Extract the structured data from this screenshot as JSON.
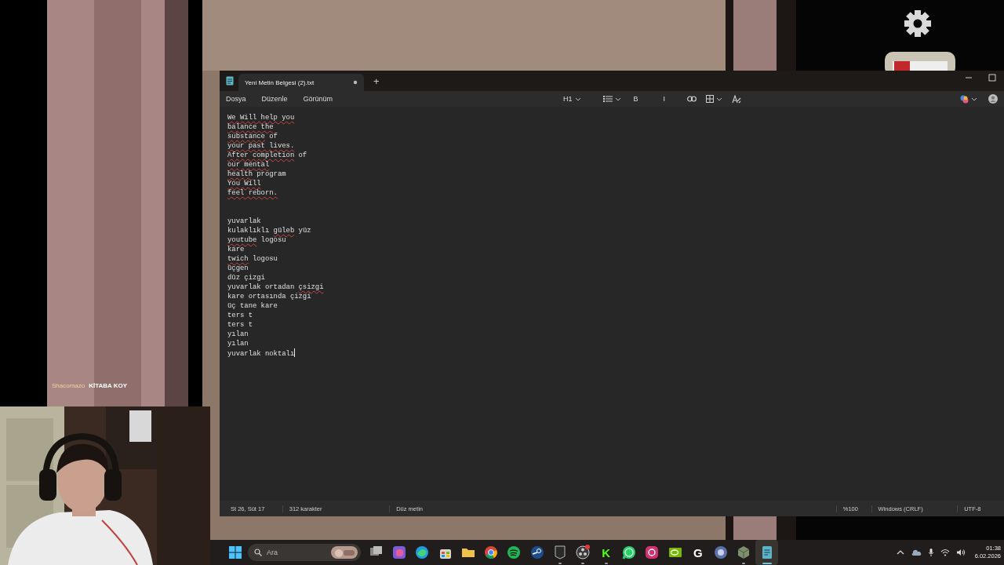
{
  "overlay": {
    "username": "Shacomazo",
    "message": "KİTABA KOY"
  },
  "notepad": {
    "tabs": [
      {
        "title": "Yeni Metin Belgesi (2).txt",
        "selected": true,
        "modified": true
      }
    ],
    "new_tab": "+",
    "menu": [
      "Dosya",
      "Düzenle",
      "Görünüm"
    ],
    "toolbar": [
      {
        "kind": "heading",
        "label": "H1",
        "dropdown": true
      },
      {
        "kind": "list",
        "dropdown": true
      },
      {
        "kind": "bold",
        "glyph": "B"
      },
      {
        "kind": "italic",
        "glyph": "I"
      },
      {
        "kind": "link"
      },
      {
        "kind": "table",
        "dropdown": true
      },
      {
        "kind": "clear-format"
      }
    ],
    "blocks": [
      {
        "lines": [
          [
            {
              "text": "We Will help you",
              "flagged": true
            }
          ],
          [
            {
              "text": "balance the",
              "flagged": true
            }
          ],
          [
            {
              "text": "substance",
              "flagged": true
            },
            {
              "text": " of",
              "flagged": false
            }
          ],
          [
            {
              "text": "your past lives.",
              "flagged": true
            }
          ],
          [
            {
              "text": "After completion",
              "flagged": true
            },
            {
              "text": " of",
              "flagged": false
            }
          ],
          [
            {
              "text": "our mental",
              "flagged": true
            }
          ],
          [
            {
              "text": "health",
              "flagged": true
            },
            {
              "text": " program",
              "flagged": false
            }
          ],
          [
            {
              "text": "You Will",
              "flagged": true
            }
          ],
          [
            {
              "text": "feel reborn.",
              "flagged": true
            }
          ]
        ]
      },
      {
        "lines": [
          [
            {
              "text": "yuvarlak",
              "flagged": false
            }
          ],
          [
            {
              "text": "kulaklıklı ",
              "flagged": false
            },
            {
              "text": "güleb",
              "flagged": true
            },
            {
              "text": " yüz",
              "flagged": false
            }
          ],
          [
            {
              "text": "youtube",
              "flagged": true
            },
            {
              "text": " logosu",
              "flagged": false
            }
          ],
          [
            {
              "text": "kare",
              "flagged": false
            }
          ],
          [
            {
              "text": "twich",
              "flagged": true
            },
            {
              "text": " logosu",
              "flagged": false
            }
          ],
          [
            {
              "text": "üçgen",
              "flagged": false
            }
          ],
          [
            {
              "text": "düz çizgi",
              "flagged": false
            }
          ],
          [
            {
              "text": "yuvarlak ortadan ",
              "flagged": false
            },
            {
              "text": "çsizgi",
              "flagged": true
            }
          ],
          [
            {
              "text": "kare ortasında çizgi",
              "flagged": false
            }
          ],
          [
            {
              "text": "üç tane kare",
              "flagged": false
            }
          ],
          [
            {
              "text": "ters t",
              "flagged": false
            }
          ],
          [
            {
              "text": "ters t",
              "flagged": false
            }
          ],
          [
            {
              "text": "yılan",
              "flagged": false
            }
          ],
          [
            {
              "text": "yılan",
              "flagged": false
            }
          ],
          [
            {
              "text": "yuvarlak noktalı",
              "flagged": false
            }
          ]
        ]
      }
    ],
    "status": {
      "position": "St 26, Süt 17",
      "count": "312 karakter",
      "format": "Düz metin",
      "zoom": "%100",
      "line_ending": "Windows (CRLF)",
      "encoding": "UTF-8"
    }
  },
  "taskbar": {
    "search_placeholder": "Ara",
    "apps": [
      {
        "kind": "task-view",
        "running": false
      },
      {
        "kind": "copilot",
        "running": false
      },
      {
        "kind": "edge",
        "running": false
      },
      {
        "kind": "store",
        "running": false
      },
      {
        "kind": "folder",
        "running": false
      },
      {
        "kind": "chrome",
        "running": false
      },
      {
        "kind": "spotify",
        "running": false
      },
      {
        "kind": "steam",
        "running": false
      },
      {
        "kind": "epic",
        "running": true
      },
      {
        "kind": "obs",
        "running": true
      },
      {
        "kind": "letter",
        "glyph": "K",
        "color": "#53fc18",
        "running": true
      },
      {
        "kind": "whatsapp",
        "running": false
      },
      {
        "kind": "instagram",
        "running": false
      },
      {
        "kind": "nvidia",
        "running": false
      },
      {
        "kind": "letter",
        "glyph": "G",
        "color": "#ffffff",
        "running": false
      },
      {
        "kind": "orb",
        "running": false
      },
      {
        "kind": "cube",
        "running": true
      },
      {
        "kind": "notepad",
        "running": true,
        "selected": true
      }
    ],
    "clock": {
      "time": "01:38",
      "date": "6.02.2026"
    }
  }
}
